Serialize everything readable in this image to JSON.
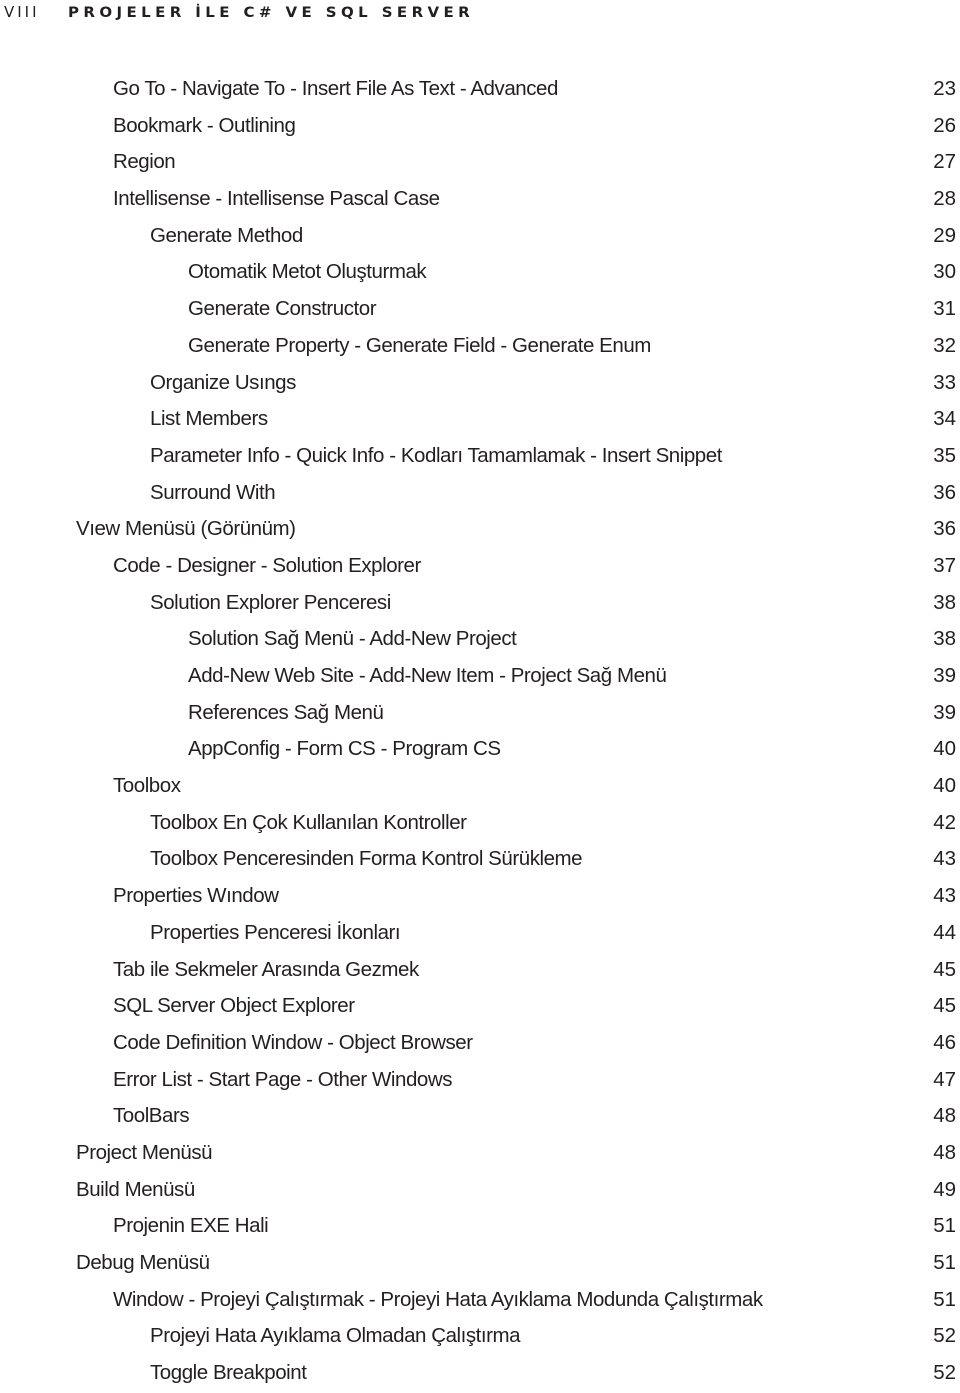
{
  "running_head": {
    "folio": "VIII",
    "book_title": "PROJELER İLE C# VE SQL SERVER"
  },
  "toc": {
    "entries": [
      {
        "level": 1,
        "title": "Go To - Navigate To - Insert File As Text - Advanced",
        "page": "23"
      },
      {
        "level": 1,
        "title": "Bookmark - Outlining",
        "page": "26"
      },
      {
        "level": 1,
        "title": "Region",
        "page": "27"
      },
      {
        "level": 1,
        "title": "Intellisense - Intellisense Pascal Case",
        "page": "28"
      },
      {
        "level": 2,
        "title": "Generate Method",
        "page": "29"
      },
      {
        "level": 3,
        "title": "Otomatik Metot Oluşturmak",
        "page": "30"
      },
      {
        "level": 3,
        "title": "Generate Constructor",
        "page": "31"
      },
      {
        "level": 3,
        "title": "Generate Property - Generate Field - Generate Enum",
        "page": "32"
      },
      {
        "level": 2,
        "title": "Organize Usıngs",
        "page": "33"
      },
      {
        "level": 2,
        "title": "List Members",
        "page": "34"
      },
      {
        "level": 2,
        "title": "Parameter Info - Quick Info - Kodları Tamamlamak - Insert Snippet",
        "page": "35"
      },
      {
        "level": 2,
        "title": "Surround With",
        "page": "36"
      },
      {
        "level": 0,
        "title": "Vıew Menüsü (Görünüm)",
        "page": "36"
      },
      {
        "level": 1,
        "title": "Code - Designer - Solution Explorer",
        "page": "37"
      },
      {
        "level": 2,
        "title": "Solution Explorer Penceresi",
        "page": "38"
      },
      {
        "level": 3,
        "title": "Solution Sağ Menü - Add-New Project",
        "page": "38"
      },
      {
        "level": 3,
        "title": "Add-New Web Site - Add-New Item - Project Sağ Menü",
        "page": "39"
      },
      {
        "level": 3,
        "title": "References Sağ Menü",
        "page": "39"
      },
      {
        "level": 3,
        "title": "AppConfig - Form CS - Program CS",
        "page": "40"
      },
      {
        "level": 1,
        "title": "Toolbox",
        "page": "40"
      },
      {
        "level": 2,
        "title": "Toolbox En Çok Kullanılan Kontroller",
        "page": "42"
      },
      {
        "level": 2,
        "title": "Toolbox Penceresinden Forma Kontrol Sürükleme",
        "page": "43"
      },
      {
        "level": 1,
        "title": "Properties Wındow",
        "page": "43"
      },
      {
        "level": 2,
        "title": "Properties Penceresi İkonları",
        "page": "44"
      },
      {
        "level": 1,
        "title": "Tab ile Sekmeler Arasında Gezmek",
        "page": "45"
      },
      {
        "level": 1,
        "title": "SQL Server Object Explorer",
        "page": "45"
      },
      {
        "level": 1,
        "title": "Code Definition Window - Object Browser",
        "page": "46"
      },
      {
        "level": 1,
        "title": "Error List - Start Page - Other Windows",
        "page": "47"
      },
      {
        "level": 1,
        "title": "ToolBars",
        "page": "48"
      },
      {
        "level": 0,
        "title": "Project Menüsü",
        "page": "48"
      },
      {
        "level": 0,
        "title": "Build Menüsü",
        "page": "49"
      },
      {
        "level": 1,
        "title": "Projenin EXE Hali",
        "page": "51"
      },
      {
        "level": 0,
        "title": "Debug Menüsü",
        "page": "51"
      },
      {
        "level": 1,
        "title": "Window - Projeyi Çalıştırmak - Projeyi Hata Ayıklama Modunda Çalıştırmak",
        "page": "51"
      },
      {
        "level": 2,
        "title": "Projeyi Hata Ayıklama Olmadan Çalıştırma",
        "page": "52"
      },
      {
        "level": 2,
        "title": "Toggle Breakpoint",
        "page": "52"
      }
    ]
  }
}
